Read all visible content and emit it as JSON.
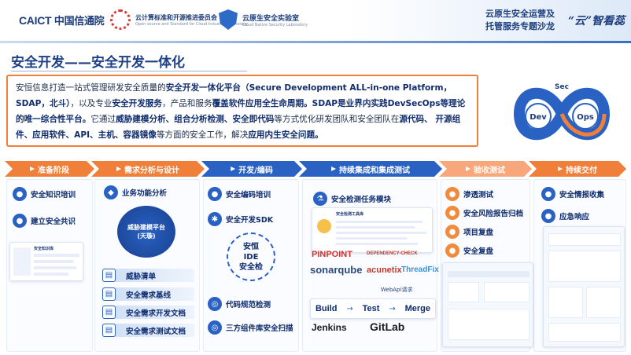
{
  "header": {
    "caict_logo": "CAICT",
    "caict_cn": "中国信通院",
    "org2_name": "云计算标准和开源推进委员会",
    "org2_sub": "Open source and Standard for Cloud Industry Technology",
    "org3_name": "云原生安全实验室",
    "org3_sub": "Cloud Native Security Laboratory",
    "event_line1": "云原生安全运营及",
    "event_line2": "托管服务专题沙龙",
    "brand": "“云”智看蕊"
  },
  "page_title": "安全开发——安全开发一体化",
  "description": {
    "p1": "安恒信息打造一站式管理研发安全质量的",
    "b1": "安全开发一体化平台（Secure Development ALL-in-one Platform，SDAP，北斗）",
    "p2": "，以及专业",
    "b2": "安全开发服务",
    "p3": "，产品和服务",
    "b3": "覆盖软件应用全生命周期。SDAP是业界内实践DevSecOps等理论的唯一综合性平台。",
    "p4": "它通过",
    "b4": "威胁建模分析、组合分析检测、安全即代码",
    "p5": "等方式优化研发团队和安全团队在",
    "b5": "源代码、 开源组件、应用软件、API、主机、容器镜像",
    "p6": "等方面的安全工作，解决",
    "b6": "应用内生安全问题。"
  },
  "devops": {
    "sec": "Sec",
    "dev": "Dev",
    "ops": "Ops"
  },
  "stages": [
    {
      "label": "准备阶段",
      "color": "#f07f3a"
    },
    {
      "label": "需求分析与设计",
      "color": "#f07f3a"
    },
    {
      "label": "开发/编码",
      "color": "#2a62c4"
    },
    {
      "label": "持续集成和集成测试",
      "color": "#2a62c4"
    },
    {
      "label": "验收测试",
      "color": "#f7a77a"
    },
    {
      "label": "持续交付",
      "color": "#f07f3a"
    }
  ],
  "prep": {
    "items": [
      "安全知识培训",
      "建立安全共识"
    ],
    "card_title": "安全知识库"
  },
  "design": {
    "top": "业务功能分析",
    "core_line1": "威胁建模平台",
    "core_line2": "(天璇)",
    "items": [
      "威胁清单",
      "安全需求基线",
      "安全需求开发文档",
      "安全需求测试文档"
    ]
  },
  "dev": {
    "items": [
      "安全编码培训",
      "安全开发SDK"
    ],
    "ide_line1": "安恒",
    "ide_line2": "IDE",
    "ide_line3": "安全检",
    "bottom_items": [
      "代码规范检测",
      "三方组件库安全扫描"
    ]
  },
  "ci": {
    "module": "安全检测任务模块",
    "panel_title": "安全检测工具库",
    "webapi": "WebApi请求",
    "flow": [
      "Build",
      "Test",
      "Merge"
    ],
    "tools": [
      "PINPOINT",
      "DEPENDENCY-CHECK",
      "sonarqube",
      "acunetix",
      "ThreadFix",
      "Jenkins",
      "GitLab"
    ]
  },
  "accept": {
    "items": [
      "渗透测试",
      "安全风险报告归档",
      "项目复盘",
      "安全复盘"
    ]
  },
  "deliver": {
    "items": [
      "安全情报收集",
      "应急响应"
    ]
  }
}
